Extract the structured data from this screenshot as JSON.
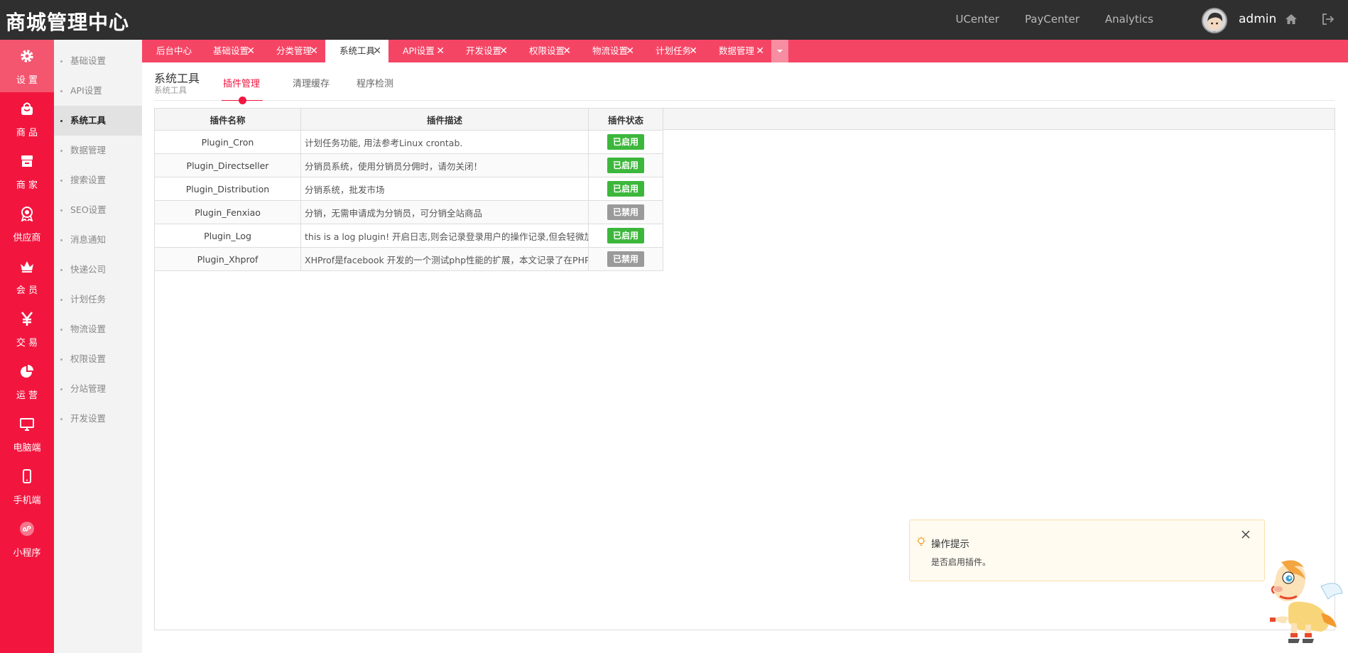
{
  "header": {
    "logo": "商城管理中心",
    "links": [
      "UCenter",
      "PayCenter",
      "Analytics"
    ],
    "user": "admin"
  },
  "leftnav": [
    {
      "label": "设 置",
      "icon": "gear-icon"
    },
    {
      "label": "商 品",
      "icon": "bag-icon"
    },
    {
      "label": "商 家",
      "icon": "store-icon"
    },
    {
      "label": "供应商",
      "icon": "award-icon"
    },
    {
      "label": "会 员",
      "icon": "crown-icon"
    },
    {
      "label": "交 易",
      "icon": "yen-icon"
    },
    {
      "label": "运 营",
      "icon": "pie-chart-icon"
    },
    {
      "label": "电脑端",
      "icon": "monitor-icon"
    },
    {
      "label": "手机端",
      "icon": "mobile-icon"
    },
    {
      "label": "小程序",
      "icon": "mini-program-icon"
    }
  ],
  "submenu": [
    "基础设置",
    "API设置",
    "系统工具",
    "数据管理",
    "搜索设置",
    "SEO设置",
    "消息通知",
    "快递公司",
    "计划任务",
    "物流设置",
    "权限设置",
    "分站管理",
    "开发设置"
  ],
  "tabs": [
    {
      "label": "后台中心",
      "closable": false
    },
    {
      "label": "基础设置",
      "closable": true
    },
    {
      "label": "分类管理",
      "closable": true
    },
    {
      "label": "系统工具",
      "closable": true
    },
    {
      "label": "API设置",
      "closable": true
    },
    {
      "label": "开发设置",
      "closable": true
    },
    {
      "label": "权限设置",
      "closable": true
    },
    {
      "label": "物流设置",
      "closable": true
    },
    {
      "label": "计划任务",
      "closable": true
    },
    {
      "label": "数据管理",
      "closable": true
    }
  ],
  "page": {
    "title": "系统工具",
    "subtitle": "系统工具",
    "subtabs": [
      "插件管理",
      "清理缓存",
      "程序检测"
    ]
  },
  "table": {
    "columns": [
      "插件名称",
      "插件描述",
      "插件状态"
    ],
    "rows": [
      {
        "name": "Plugin_Cron",
        "desc": "计划任务功能, 用法参考Linux crontab.",
        "status": "已启用",
        "enabled": true
      },
      {
        "name": "Plugin_Directseller",
        "desc": "分销员系统，使用分销员分佣时，请勿关闭！",
        "status": "已启用",
        "enabled": true
      },
      {
        "name": "Plugin_Distribution",
        "desc": "分销系统，批发市场",
        "status": "已启用",
        "enabled": true
      },
      {
        "name": "Plugin_Fenxiao",
        "desc": "分销，无需申请成为分销员，可分销全站商品",
        "status": "已禁用",
        "enabled": false
      },
      {
        "name": "Plugin_Log",
        "desc": "this is a log plugin! 开启日志,则会记录登录用户的操作记录,但会轻微加...",
        "status": "已启用",
        "enabled": true
      },
      {
        "name": "Plugin_Xhprof",
        "desc": "XHProf是facebook 开发的一个测试php性能的扩展，本文记录了在PHP...",
        "status": "已禁用",
        "enabled": false
      }
    ]
  },
  "tip": {
    "title": "操作提示",
    "text": "是否启用插件。"
  },
  "colors": {
    "brand_red": "#f2163f",
    "tab_bar": "#f54565",
    "enabled_green": "#3cb73c",
    "disabled_gray": "#9a9a9a"
  }
}
